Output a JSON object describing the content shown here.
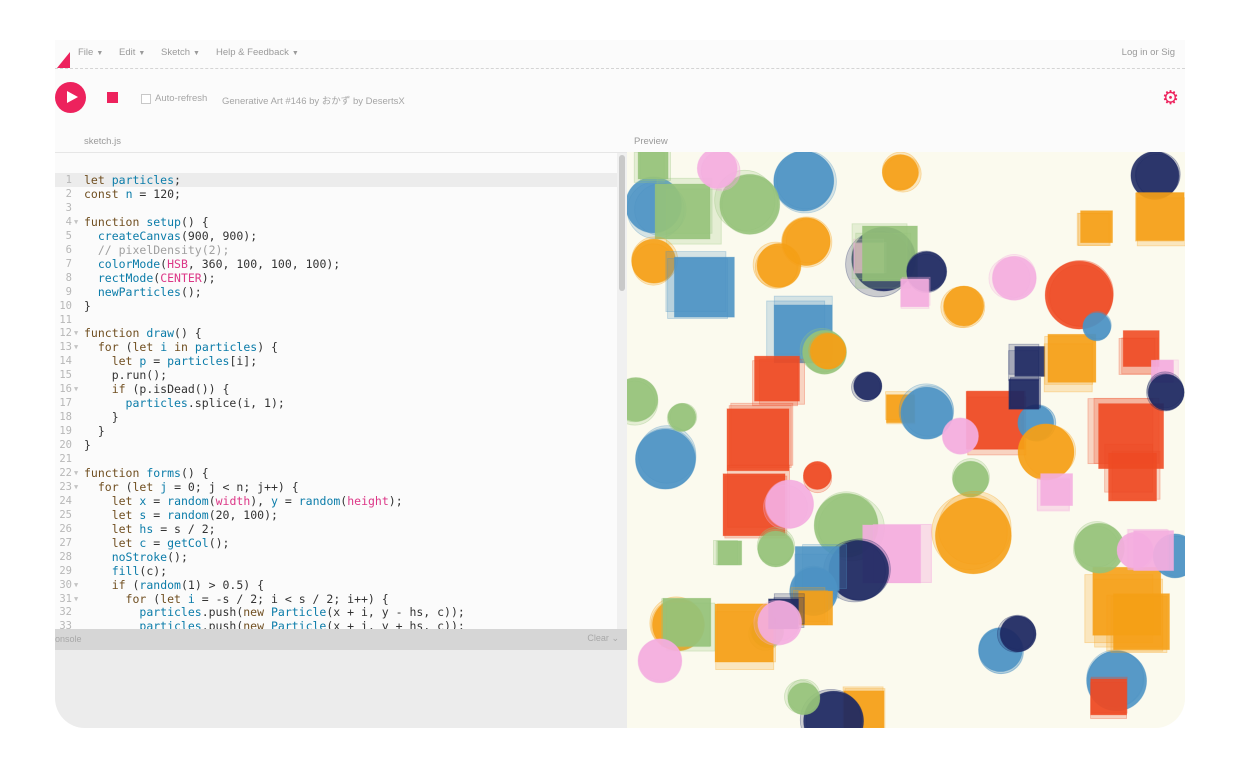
{
  "menubar": {
    "items": [
      "File",
      "Edit",
      "Sketch",
      "Help & Feedback"
    ],
    "auth": "Log in  or  Sig"
  },
  "toolbar": {
    "auto_refresh_label": "Auto-refresh",
    "project_title": "Generative Art #146 by おかず  by DesertsX"
  },
  "editor": {
    "file_name": "sketch.js",
    "lines": [
      {
        "n": "1",
        "fold": false,
        "active": true,
        "html": "<span class='kw'>let</span> <span class='fn'>particles</span>;"
      },
      {
        "n": "2",
        "fold": false,
        "html": "<span class='kw'>const</span> <span class='fn'>n</span> = 120;"
      },
      {
        "n": "3",
        "fold": false,
        "html": ""
      },
      {
        "n": "4",
        "fold": true,
        "html": "<span class='kw'>function</span> <span class='fn'>setup</span>() {"
      },
      {
        "n": "5",
        "fold": false,
        "html": "  <span class='fn'>createCanvas</span>(900, 900);"
      },
      {
        "n": "6",
        "fold": false,
        "html": "  <span class='cm'>// pixelDensity(2);</span>"
      },
      {
        "n": "7",
        "fold": false,
        "html": "  <span class='fn'>colorMode</span>(<span class='cn'>HSB</span>, 360, 100, 100, 100);"
      },
      {
        "n": "8",
        "fold": false,
        "html": "  <span class='fn'>rectMode</span>(<span class='cn'>CENTER</span>);"
      },
      {
        "n": "9",
        "fold": false,
        "html": "  <span class='fn'>newParticles</span>();"
      },
      {
        "n": "10",
        "fold": false,
        "html": "}"
      },
      {
        "n": "11",
        "fold": false,
        "html": ""
      },
      {
        "n": "12",
        "fold": true,
        "html": "<span class='kw'>function</span> <span class='fn'>draw</span>() {"
      },
      {
        "n": "13",
        "fold": true,
        "html": "  <span class='kw'>for</span> (<span class='kw'>let</span> <span class='fn'>i</span> <span class='kw'>in</span> <span class='fn'>particles</span>) {"
      },
      {
        "n": "14",
        "fold": false,
        "html": "    <span class='kw'>let</span> <span class='fn'>p</span> = <span class='fn'>particles</span>[i];"
      },
      {
        "n": "15",
        "fold": false,
        "html": "    p.run();"
      },
      {
        "n": "16",
        "fold": true,
        "html": "    <span class='kw'>if</span> (p.isDead()) {"
      },
      {
        "n": "17",
        "fold": false,
        "html": "      <span class='fn'>particles</span>.splice(i, 1);"
      },
      {
        "n": "18",
        "fold": false,
        "html": "    }"
      },
      {
        "n": "19",
        "fold": false,
        "html": "  }"
      },
      {
        "n": "20",
        "fold": false,
        "html": "}"
      },
      {
        "n": "21",
        "fold": false,
        "html": ""
      },
      {
        "n": "22",
        "fold": true,
        "html": "<span class='kw'>function</span> <span class='fn'>forms</span>() {"
      },
      {
        "n": "23",
        "fold": true,
        "html": "  <span class='kw'>for</span> (<span class='kw'>let</span> <span class='fn'>j</span> = 0; j &lt; n; j++) {"
      },
      {
        "n": "24",
        "fold": false,
        "html": "    <span class='kw'>let</span> <span class='fn'>x</span> = <span class='fn'>random</span>(<span class='cn'>width</span>), <span class='fn'>y</span> = <span class='fn'>random</span>(<span class='cn'>height</span>);"
      },
      {
        "n": "25",
        "fold": false,
        "html": "    <span class='kw'>let</span> <span class='fn'>s</span> = <span class='fn'>random</span>(20, 100);"
      },
      {
        "n": "26",
        "fold": false,
        "html": "    <span class='kw'>let</span> <span class='fn'>hs</span> = s / 2;"
      },
      {
        "n": "27",
        "fold": false,
        "html": "    <span class='kw'>let</span> <span class='fn'>c</span> = <span class='fn'>getCol</span>();"
      },
      {
        "n": "28",
        "fold": false,
        "html": "    <span class='fn'>noStroke</span>();"
      },
      {
        "n": "29",
        "fold": false,
        "html": "    <span class='fn'>fill</span>(c);"
      },
      {
        "n": "30",
        "fold": true,
        "html": "    <span class='kw'>if</span> (<span class='fn'>random</span>(1) &gt; 0.5) {"
      },
      {
        "n": "31",
        "fold": true,
        "html": "      <span class='kw'>for</span> (<span class='kw'>let</span> <span class='fn'>i</span> = -s / 2; i &lt; s / 2; i++) {"
      },
      {
        "n": "32",
        "fold": false,
        "html": "        <span class='fn'>particles</span>.push(<span class='kw'>new</span> <span class='fn'>Particle</span>(x + i, y - hs, c));"
      },
      {
        "n": "33",
        "fold": false,
        "html": "        <span class='fn'>particles</span>.push(<span class='kw'>new</span> <span class='fn'>Particle</span>(x + i, y + hs, c));"
      }
    ]
  },
  "preview": {
    "label": "Preview"
  },
  "console": {
    "label": "onsole",
    "clear_label": "Clear"
  },
  "colors": {
    "accent": "#ed225d",
    "palette": [
      "#4c93c4",
      "#f5a017",
      "#ef4b24",
      "#96c27a",
      "#f4aee0",
      "#1f2a63"
    ]
  },
  "icons": [
    "play-icon",
    "stop-icon",
    "gear-icon",
    "chevron-down-icon",
    "processing-logo-icon"
  ]
}
